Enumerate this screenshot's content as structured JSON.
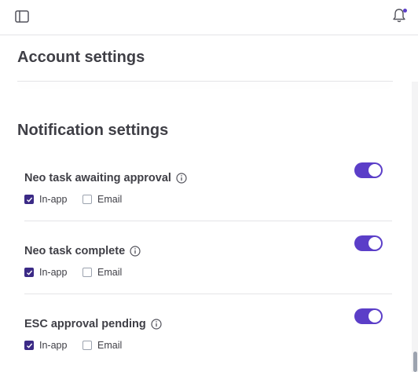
{
  "header": {
    "sidebar_icon": "sidebar-toggle-icon",
    "bell_icon": "notification-bell-icon",
    "has_unread": true
  },
  "account_settings": {
    "title": "Account settings"
  },
  "notification_settings": {
    "title": "Notification settings",
    "items": [
      {
        "label": "Neo task awaiting approval",
        "enabled": true,
        "in_app_label": "In-app",
        "in_app_checked": true,
        "email_label": "Email",
        "email_checked": false
      },
      {
        "label": "Neo task complete",
        "enabled": true,
        "in_app_label": "In-app",
        "in_app_checked": true,
        "email_label": "Email",
        "email_checked": false
      },
      {
        "label": "ESC approval pending",
        "enabled": true,
        "in_app_label": "In-app",
        "in_app_checked": true,
        "email_label": "Email",
        "email_checked": false
      }
    ]
  },
  "colors": {
    "accent": "#5b3ec8",
    "checkbox_checked": "#3b2a86",
    "text": "#3f3f46",
    "divider": "#e4e4e7"
  }
}
